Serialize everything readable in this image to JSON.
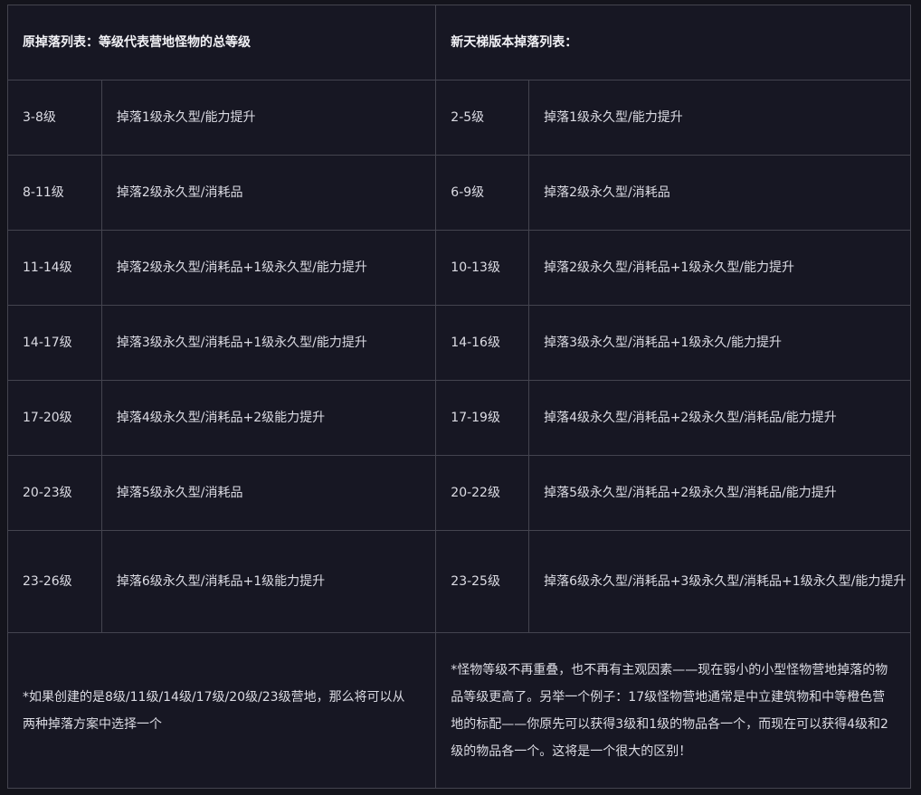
{
  "table": {
    "left_header": "原掉落列表：等级代表营地怪物的总等级",
    "right_header": "新天梯版本掉落列表：",
    "rows": [
      {
        "old_level": "3-8级",
        "old_drop": "掉落1级永久型/能力提升",
        "new_level": "2-5级",
        "new_drop": "掉落1级永久型/能力提升"
      },
      {
        "old_level": "8-11级",
        "old_drop": "掉落2级永久型/消耗品",
        "new_level": "6-9级",
        "new_drop": "掉落2级永久型/消耗品"
      },
      {
        "old_level": "11-14级",
        "old_drop": "掉落2级永久型/消耗品+1级永久型/能力提升",
        "new_level": "10-13级",
        "new_drop": "掉落2级永久型/消耗品+1级永久型/能力提升"
      },
      {
        "old_level": "14-17级",
        "old_drop": "掉落3级永久型/消耗品+1级永久型/能力提升",
        "new_level": "14-16级",
        "new_drop": "掉落3级永久型/消耗品+1级永久/能力提升"
      },
      {
        "old_level": "17-20级",
        "old_drop": "掉落4级永久型/消耗品+2级能力提升",
        "new_level": "17-19级",
        "new_drop": "掉落4级永久型/消耗品+2级永久型/消耗品/能力提升"
      },
      {
        "old_level": "20-23级",
        "old_drop": "掉落5级永久型/消耗品",
        "new_level": "20-22级",
        "new_drop": "掉落5级永久型/消耗品+2级永久型/消耗品/能力提升"
      },
      {
        "old_level": "23-26级",
        "old_drop": "掉落6级永久型/消耗品+1级能力提升",
        "new_level": "23-25级",
        "new_drop": "掉落6级永久型/消耗品+3级永久型/消耗品+1级永久型/能力提升"
      }
    ],
    "left_note": "*如果创建的是8级/11级/14级/17级/20级/23级营地，那么将可以从两种掉落方案中选择一个",
    "right_note": "*怪物等级不再重叠，也不再有主观因素——现在弱小的小型怪物营地掉落的物品等级更高了。另举一个例子：17级怪物营地通常是中立建筑物和中等橙色营地的标配——你原先可以获得3级和1级的物品各一个，而现在可以获得4级和2级的物品各一个。这将是一个很大的区别！"
  }
}
